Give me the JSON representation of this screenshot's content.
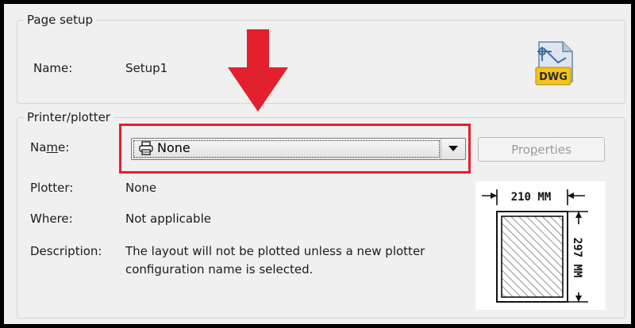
{
  "page_setup": {
    "group_title": "Page setup",
    "name_label": "Name:",
    "name_value": "Setup1",
    "file_icon": "dwg-file-icon",
    "file_icon_text": "DWG"
  },
  "printer_plotter": {
    "group_title": "Printer/plotter",
    "name_label_prefix": "Na",
    "name_label_mnemonic": "m",
    "name_label_suffix": "e:",
    "selected_printer": "None",
    "properties_prefix": "Pro",
    "properties_mnemonic": "p",
    "properties_suffix": "erties",
    "plotter_label": "Plotter:",
    "plotter_value": "None",
    "where_label": "Where:",
    "where_value": "Not applicable",
    "description_label": "Description:",
    "description_line1": "The layout will not be plotted unless a new plotter",
    "description_line2": "configuration name is selected."
  },
  "paper_preview": {
    "width_label": "210 MM",
    "height_label": "297 MM"
  },
  "annotation": {
    "arrow_color": "#e3202d",
    "highlight_color": "#e3202d"
  }
}
